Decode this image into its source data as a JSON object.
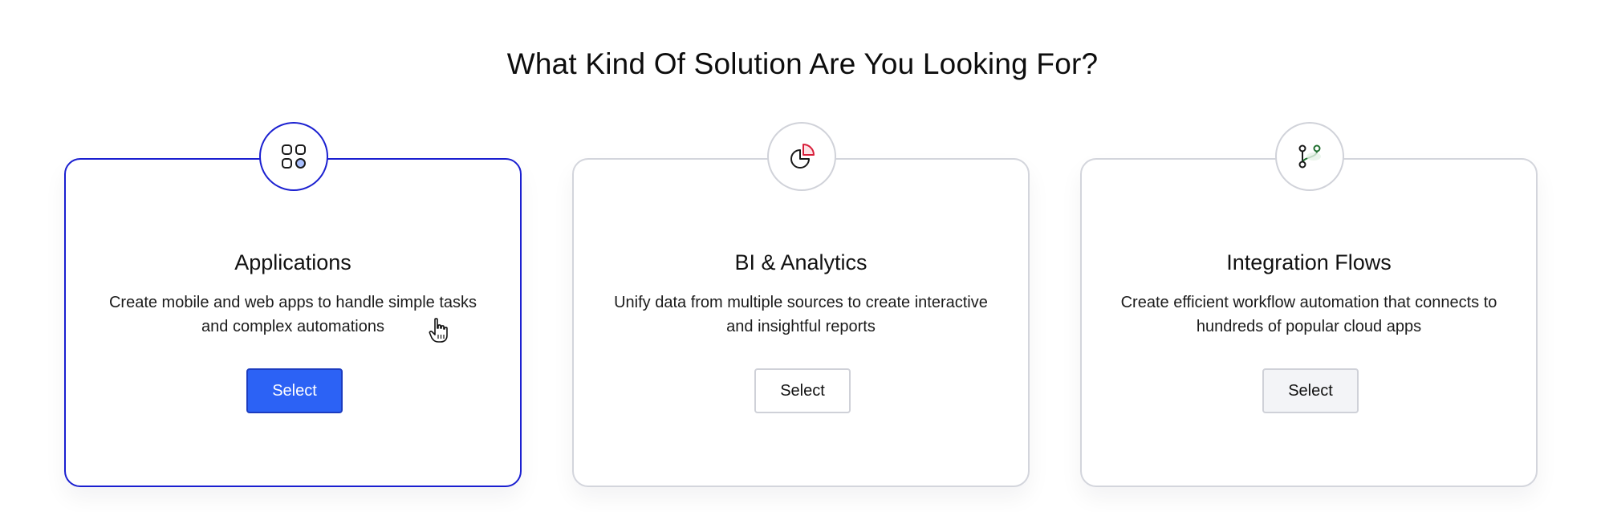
{
  "page": {
    "title": "What Kind Of Solution Are You Looking For?"
  },
  "cards": [
    {
      "icon": "apps-grid-icon",
      "title": "Applications",
      "description": "Create mobile and web apps to handle simple tasks and complex automations",
      "button_label": "Select",
      "state": "selected"
    },
    {
      "icon": "pie-chart-icon",
      "title": "BI & Analytics",
      "description": "Unify data from multiple sources to create interactive and insightful reports",
      "button_label": "Select",
      "state": "default"
    },
    {
      "icon": "git-branch-icon",
      "title": "Integration Flows",
      "description": "Create efficient workflow automation that connects to hundreds of popular cloud apps",
      "button_label": "Select",
      "state": "default"
    }
  ],
  "colors": {
    "selected_border": "#1a1fd0",
    "primary_button": "#2c62f5",
    "card_border": "#d3d5dc",
    "analytics_accent": "#d81f3a",
    "integration_accent": "#1f6e2e"
  }
}
